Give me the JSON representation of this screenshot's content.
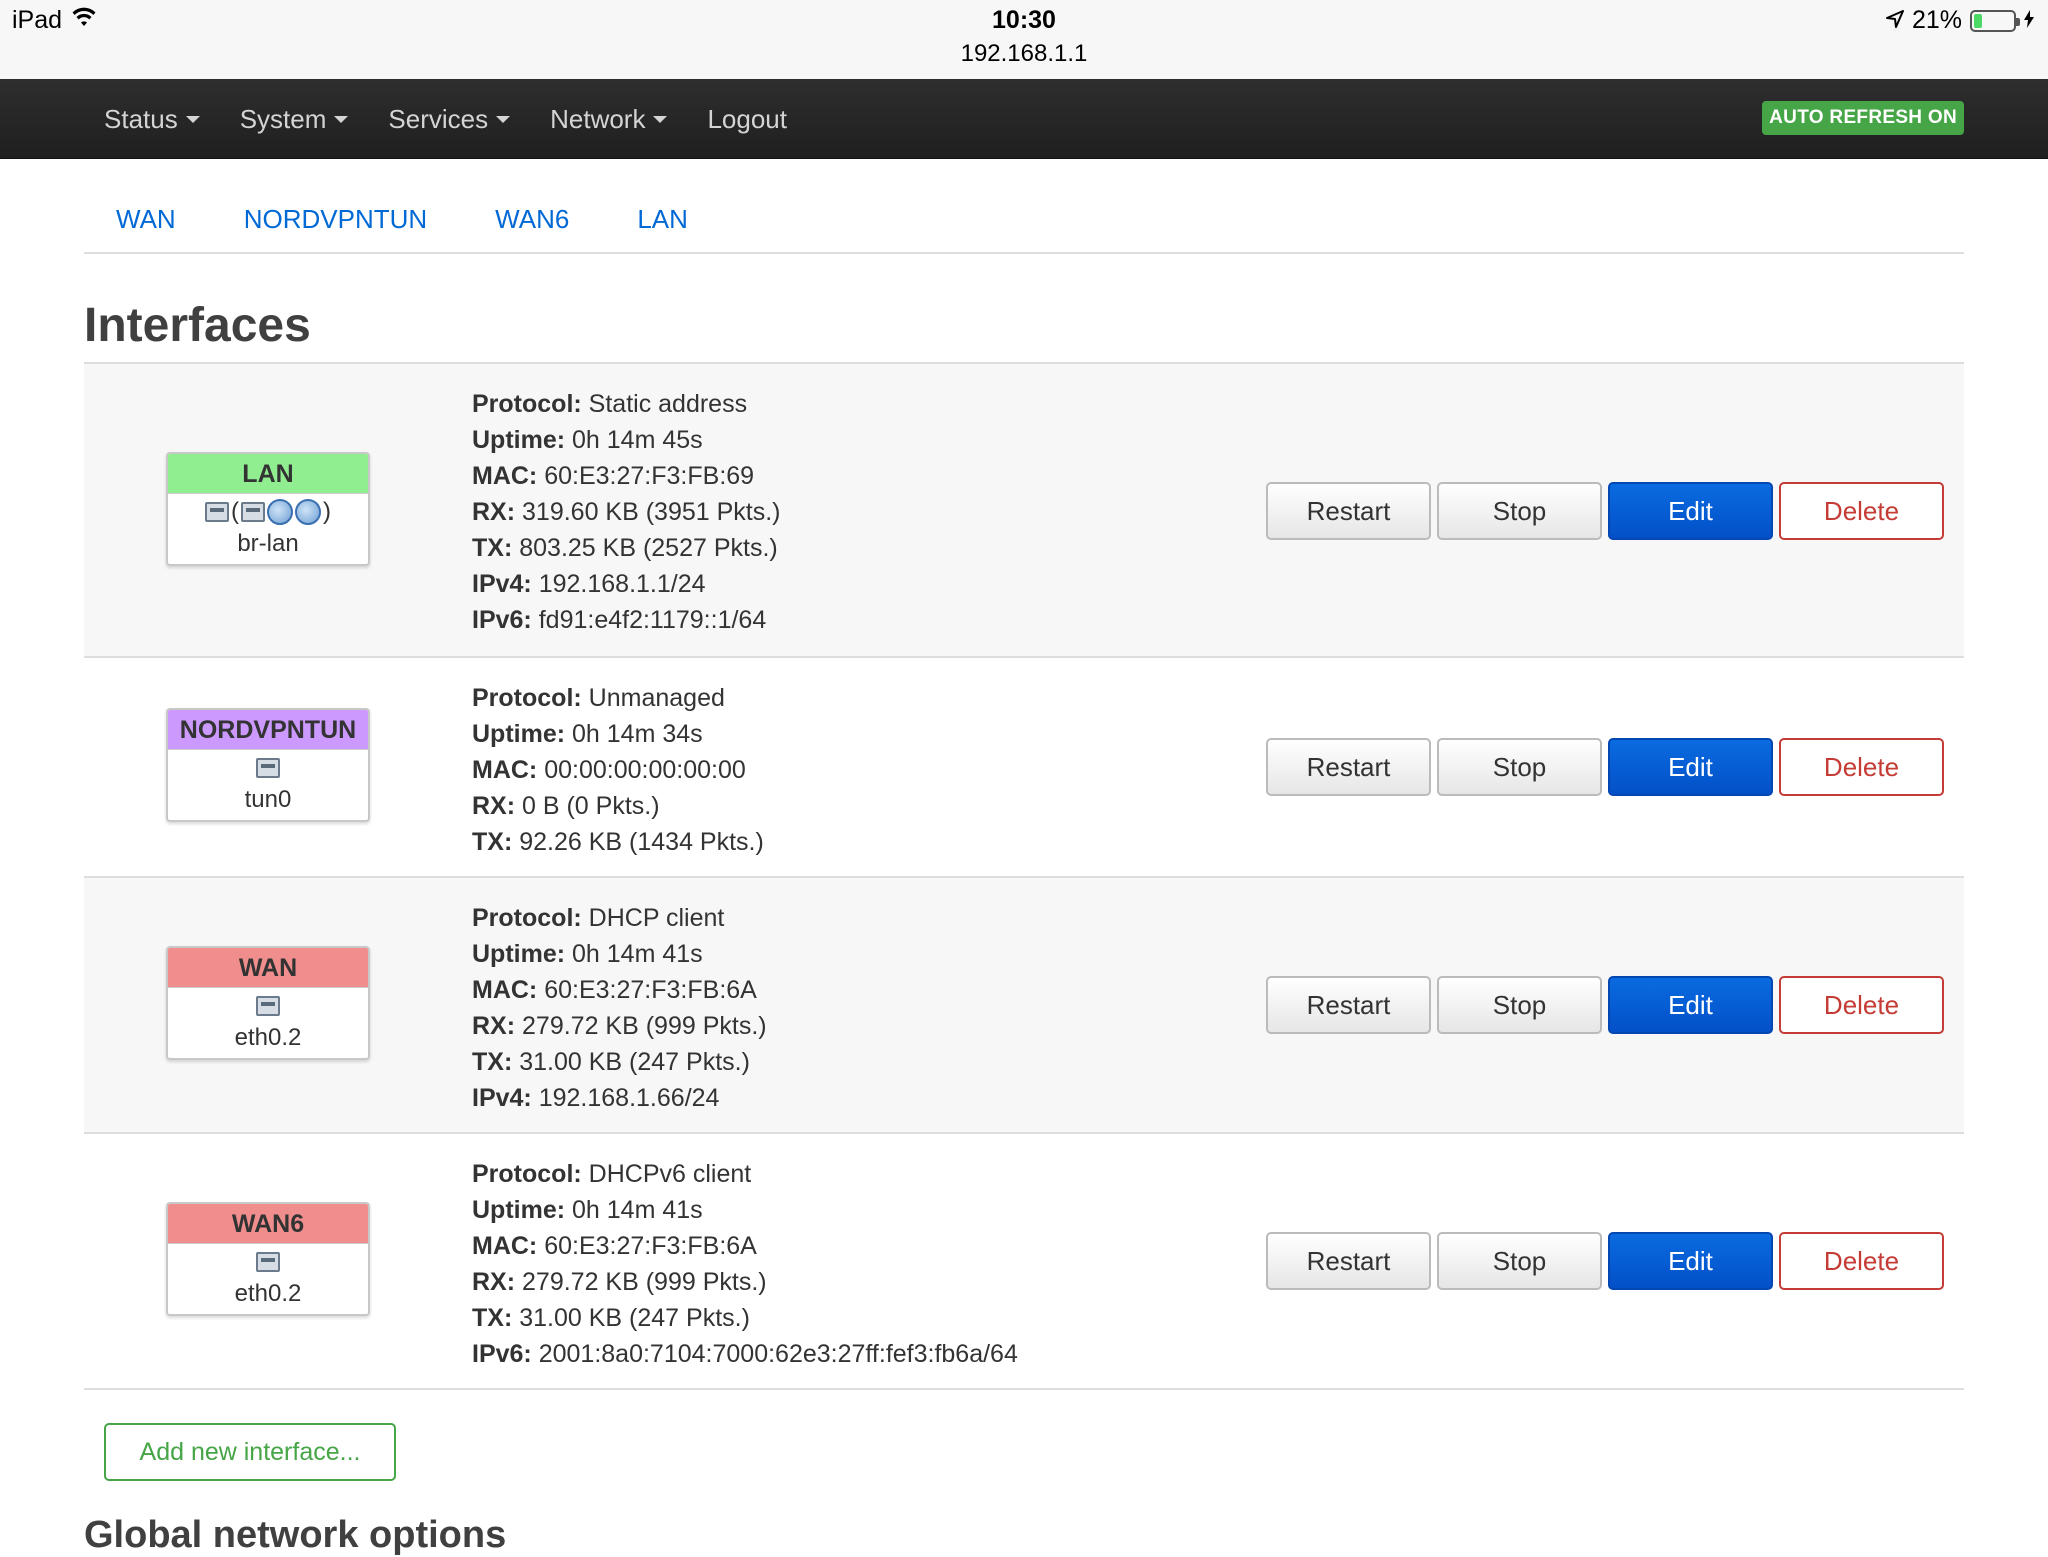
{
  "status_bar": {
    "device": "iPad",
    "time": "10:30",
    "url": "192.168.1.1",
    "battery": "21%",
    "battery_fraction": 0.21
  },
  "nav": {
    "items": [
      {
        "label": "Status",
        "dropdown": true
      },
      {
        "label": "System",
        "dropdown": true
      },
      {
        "label": "Services",
        "dropdown": true
      },
      {
        "label": "Network",
        "dropdown": true
      },
      {
        "label": "Logout",
        "dropdown": false
      }
    ],
    "auto_refresh": "AUTO REFRESH ON"
  },
  "tabs": [
    "WAN",
    "NORDVPNTUN",
    "WAN6",
    "LAN"
  ],
  "page_title": "Interfaces",
  "interfaces": [
    {
      "name": "LAN",
      "header_color": "#90ee90",
      "icons": "( )",
      "device": "br-lan",
      "details": [
        {
          "label": "Protocol:",
          "value": "Static address"
        },
        {
          "label": "Uptime:",
          "value": "0h 14m 45s"
        },
        {
          "label": "MAC:",
          "value": "60:E3:27:F3:FB:69"
        },
        {
          "label": "RX:",
          "value": "319.60 KB (3951 Pkts.)"
        },
        {
          "label": "TX:",
          "value": "803.25 KB (2527 Pkts.)"
        },
        {
          "label": "IPv4:",
          "value": "192.168.1.1/24"
        },
        {
          "label": "IPv6:",
          "value": "fd91:e4f2:1179::1/64"
        }
      ]
    },
    {
      "name": "NORDVPNTUN",
      "header_color": "#cc99ff",
      "device": "tun0",
      "details": [
        {
          "label": "Protocol:",
          "value": "Unmanaged"
        },
        {
          "label": "Uptime:",
          "value": "0h 14m 34s"
        },
        {
          "label": "MAC:",
          "value": "00:00:00:00:00:00"
        },
        {
          "label": "RX:",
          "value": "0 B (0 Pkts.)"
        },
        {
          "label": "TX:",
          "value": "92.26 KB (1434 Pkts.)"
        }
      ]
    },
    {
      "name": "WAN",
      "header_color": "#f08e8e",
      "device": "eth0.2",
      "details": [
        {
          "label": "Protocol:",
          "value": "DHCP client"
        },
        {
          "label": "Uptime:",
          "value": "0h 14m 41s"
        },
        {
          "label": "MAC:",
          "value": "60:E3:27:F3:FB:6A"
        },
        {
          "label": "RX:",
          "value": "279.72 KB (999 Pkts.)"
        },
        {
          "label": "TX:",
          "value": "31.00 KB (247 Pkts.)"
        },
        {
          "label": "IPv4:",
          "value": "192.168.1.66/24"
        }
      ]
    },
    {
      "name": "WAN6",
      "header_color": "#f08e8e",
      "device": "eth0.2",
      "details": [
        {
          "label": "Protocol:",
          "value": "DHCPv6 client"
        },
        {
          "label": "Uptime:",
          "value": "0h 14m 41s"
        },
        {
          "label": "MAC:",
          "value": "60:E3:27:F3:FB:6A"
        },
        {
          "label": "RX:",
          "value": "279.72 KB (999 Pkts.)"
        },
        {
          "label": "TX:",
          "value": "31.00 KB (247 Pkts.)"
        },
        {
          "label": "IPv6:",
          "value": "2001:8a0:7104:7000:62e3:27ff:fef3:fb6a/64"
        }
      ]
    }
  ],
  "actions": {
    "restart": "Restart",
    "stop": "Stop",
    "edit": "Edit",
    "delete": "Delete"
  },
  "add_interface": "Add new interface...",
  "global_title": "Global network options"
}
